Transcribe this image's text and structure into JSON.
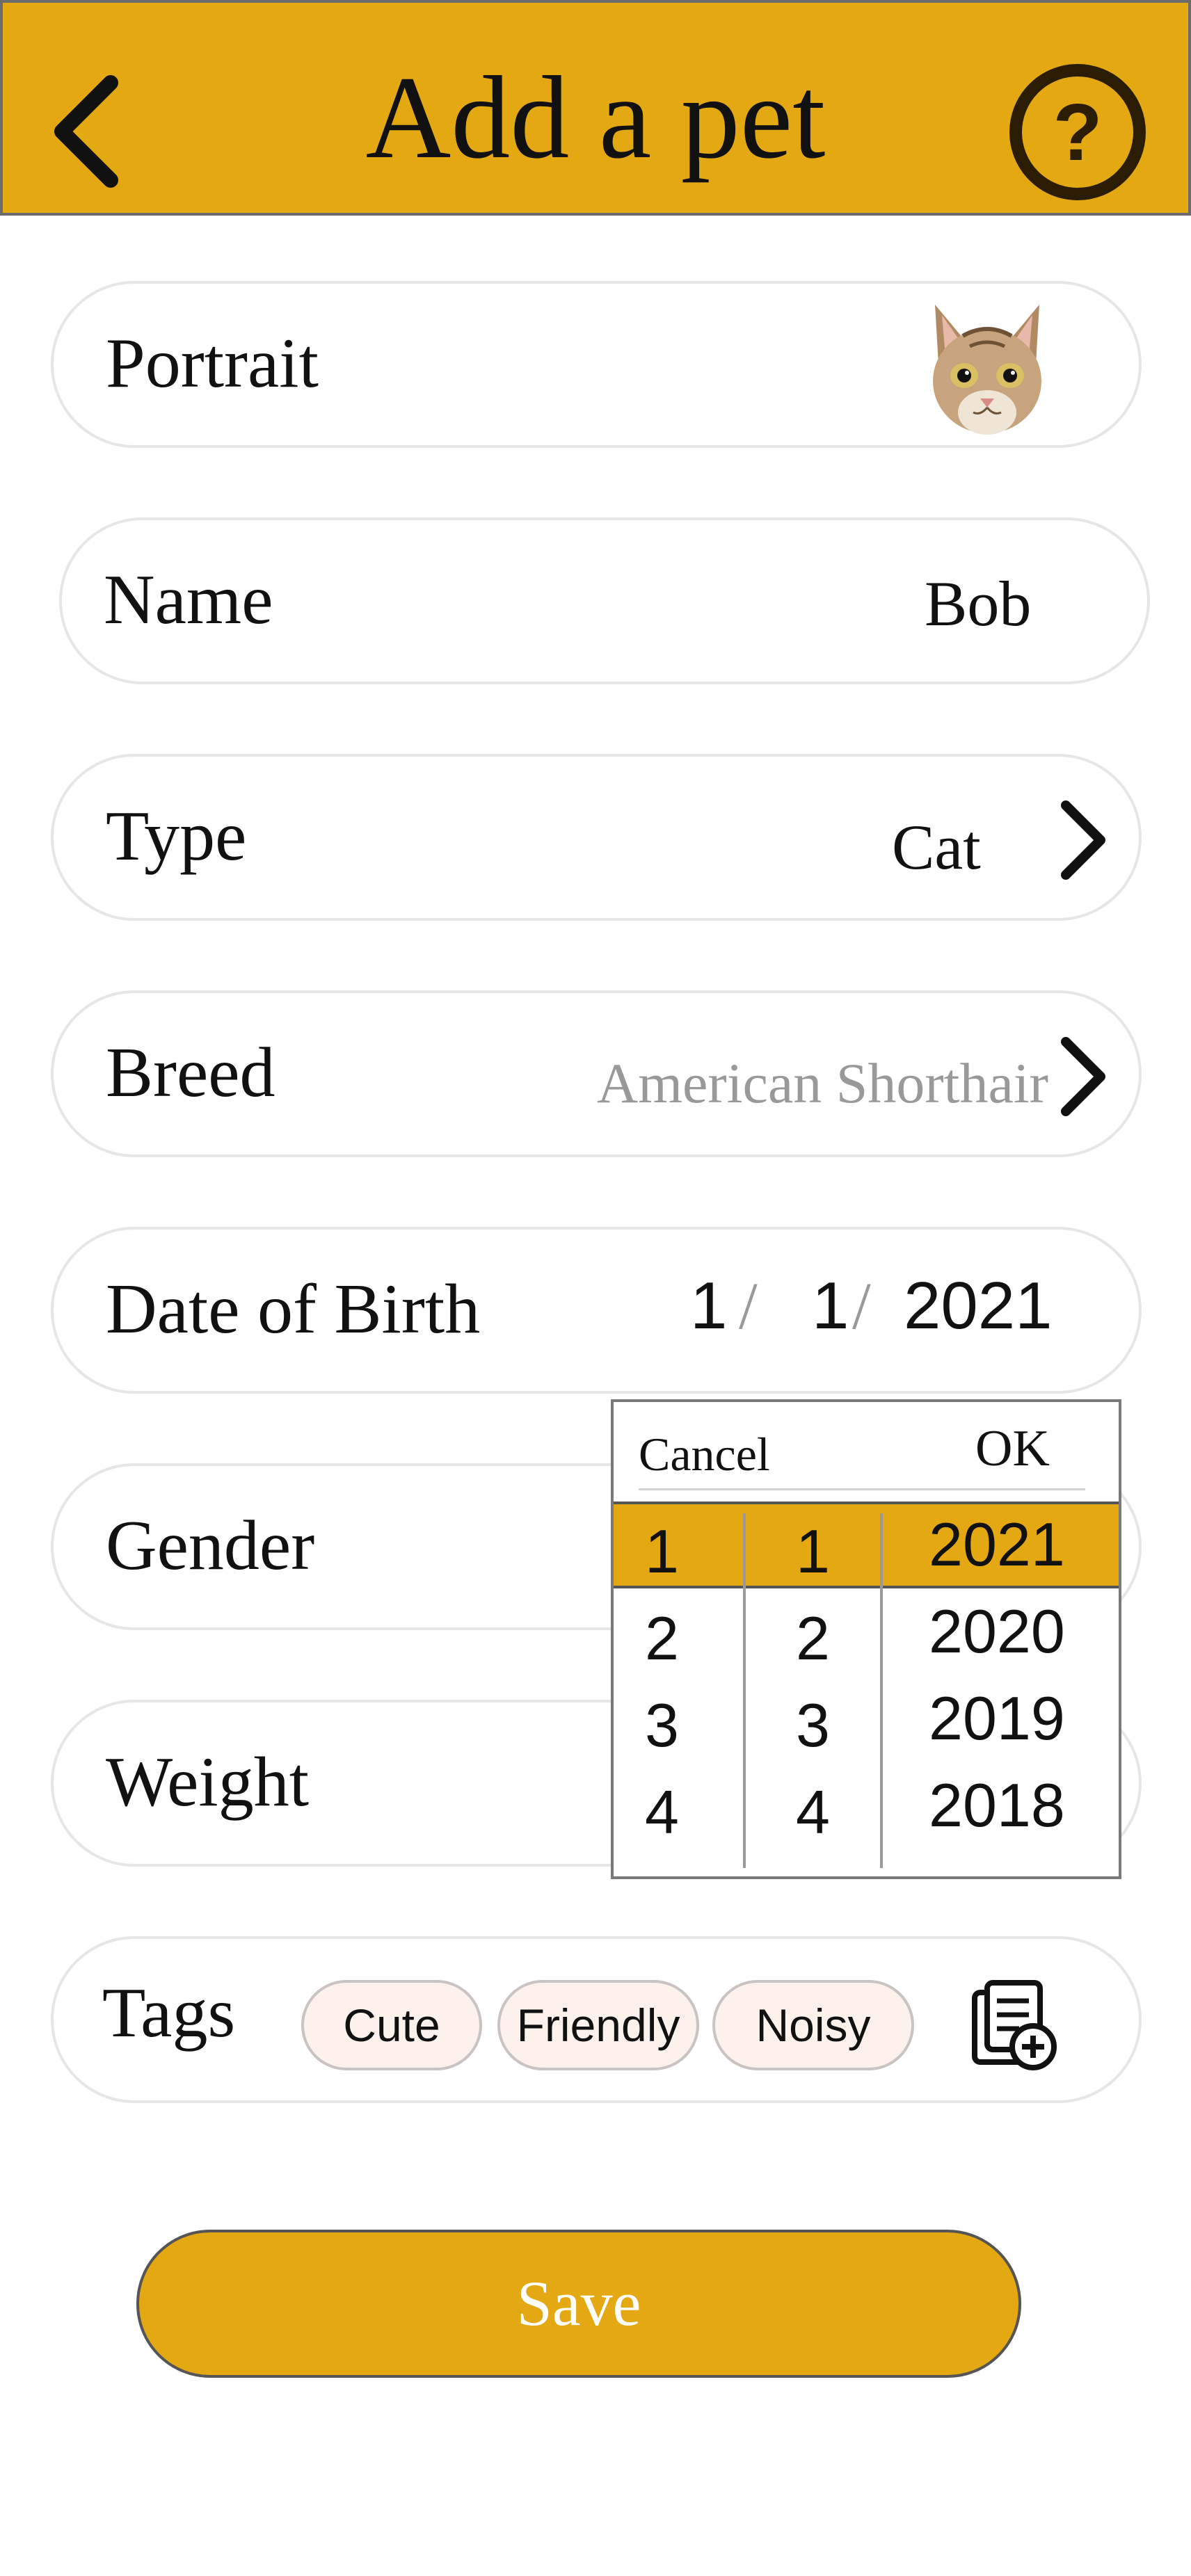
{
  "header": {
    "title": "Add a pet",
    "help_glyph": "?"
  },
  "colors": {
    "accent": "#e3a812",
    "tag_fill": "#fdf1ec",
    "placeholder": "#999999"
  },
  "form": {
    "portrait": {
      "label": "Portrait",
      "image_alt": "cat photo"
    },
    "name": {
      "label": "Name",
      "value": "Bob"
    },
    "type": {
      "label": "Type",
      "value": "Cat"
    },
    "breed": {
      "label": "Breed",
      "placeholder": "American Shorthair"
    },
    "dob": {
      "label": "Date of Birth",
      "month": "1",
      "day": "1",
      "year": "2021",
      "sep": "/"
    },
    "gender": {
      "label": "Gender"
    },
    "weight": {
      "label": "Weight"
    },
    "tags": {
      "label": "Tags",
      "items": [
        "Cute",
        "Friendly",
        "Noisy"
      ]
    }
  },
  "picker": {
    "cancel_label": "Cancel",
    "ok_label": "OK",
    "months": [
      "1",
      "2",
      "3",
      "4"
    ],
    "days": [
      "1",
      "2",
      "3",
      "4"
    ],
    "years": [
      "2021",
      "2020",
      "2019",
      "2018"
    ]
  },
  "save_label": "Save"
}
